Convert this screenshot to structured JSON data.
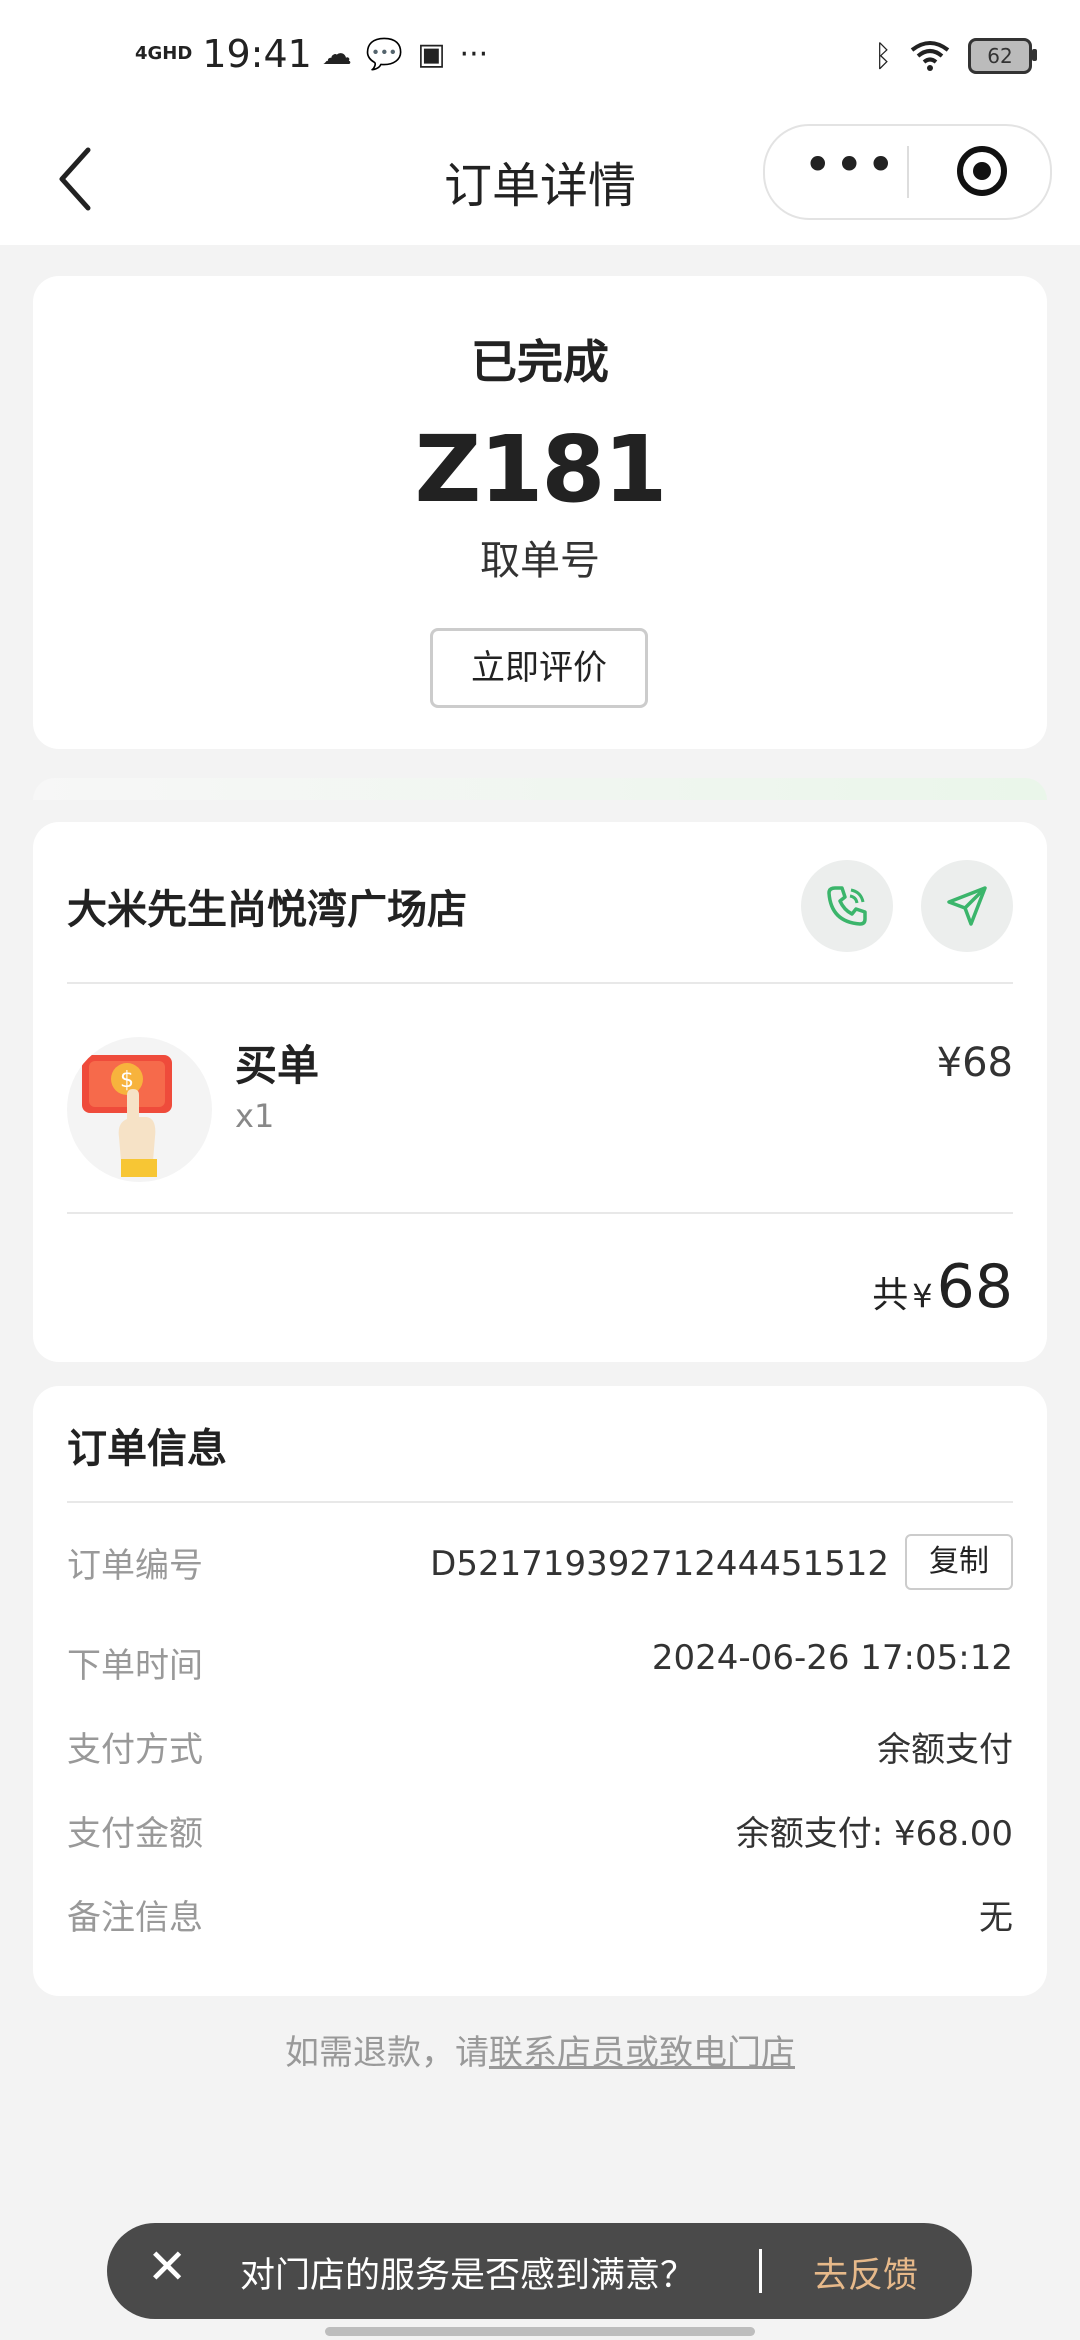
{
  "status_bar": {
    "network": "4GHD",
    "time": "19:41",
    "battery": "62"
  },
  "nav": {
    "title": "订单详情"
  },
  "order_status": {
    "status": "已完成",
    "pickup_code": "Z181",
    "pickup_label": "取单号",
    "review_button": "立即评价"
  },
  "store": {
    "name": "大米先生尚悦湾广场店",
    "item": {
      "name": "买单",
      "qty": "x1",
      "price": "¥68"
    },
    "total_label": "共",
    "total_currency": "¥",
    "total_amount": "68"
  },
  "order_info": {
    "title": "订单信息",
    "rows": [
      {
        "label": "订单编号",
        "value": "D52171939271244451512"
      },
      {
        "label": "下单时间",
        "value": "2024-06-26 17:05:12"
      },
      {
        "label": "支付方式",
        "value": "余额支付"
      },
      {
        "label": "支付金额",
        "value": "余额支付: ¥68.00"
      },
      {
        "label": "备注信息",
        "value": "无"
      }
    ],
    "copy_button": "复制"
  },
  "refund": {
    "prefix": "如需退款，请",
    "link": "联系店员或致电门店"
  },
  "feedback_bar": {
    "question": "对门店的服务是否感到满意？",
    "action": "去反馈"
  },
  "colors": {
    "accent_green": "#3bb56b",
    "feedback_action": "#e7b98a"
  }
}
